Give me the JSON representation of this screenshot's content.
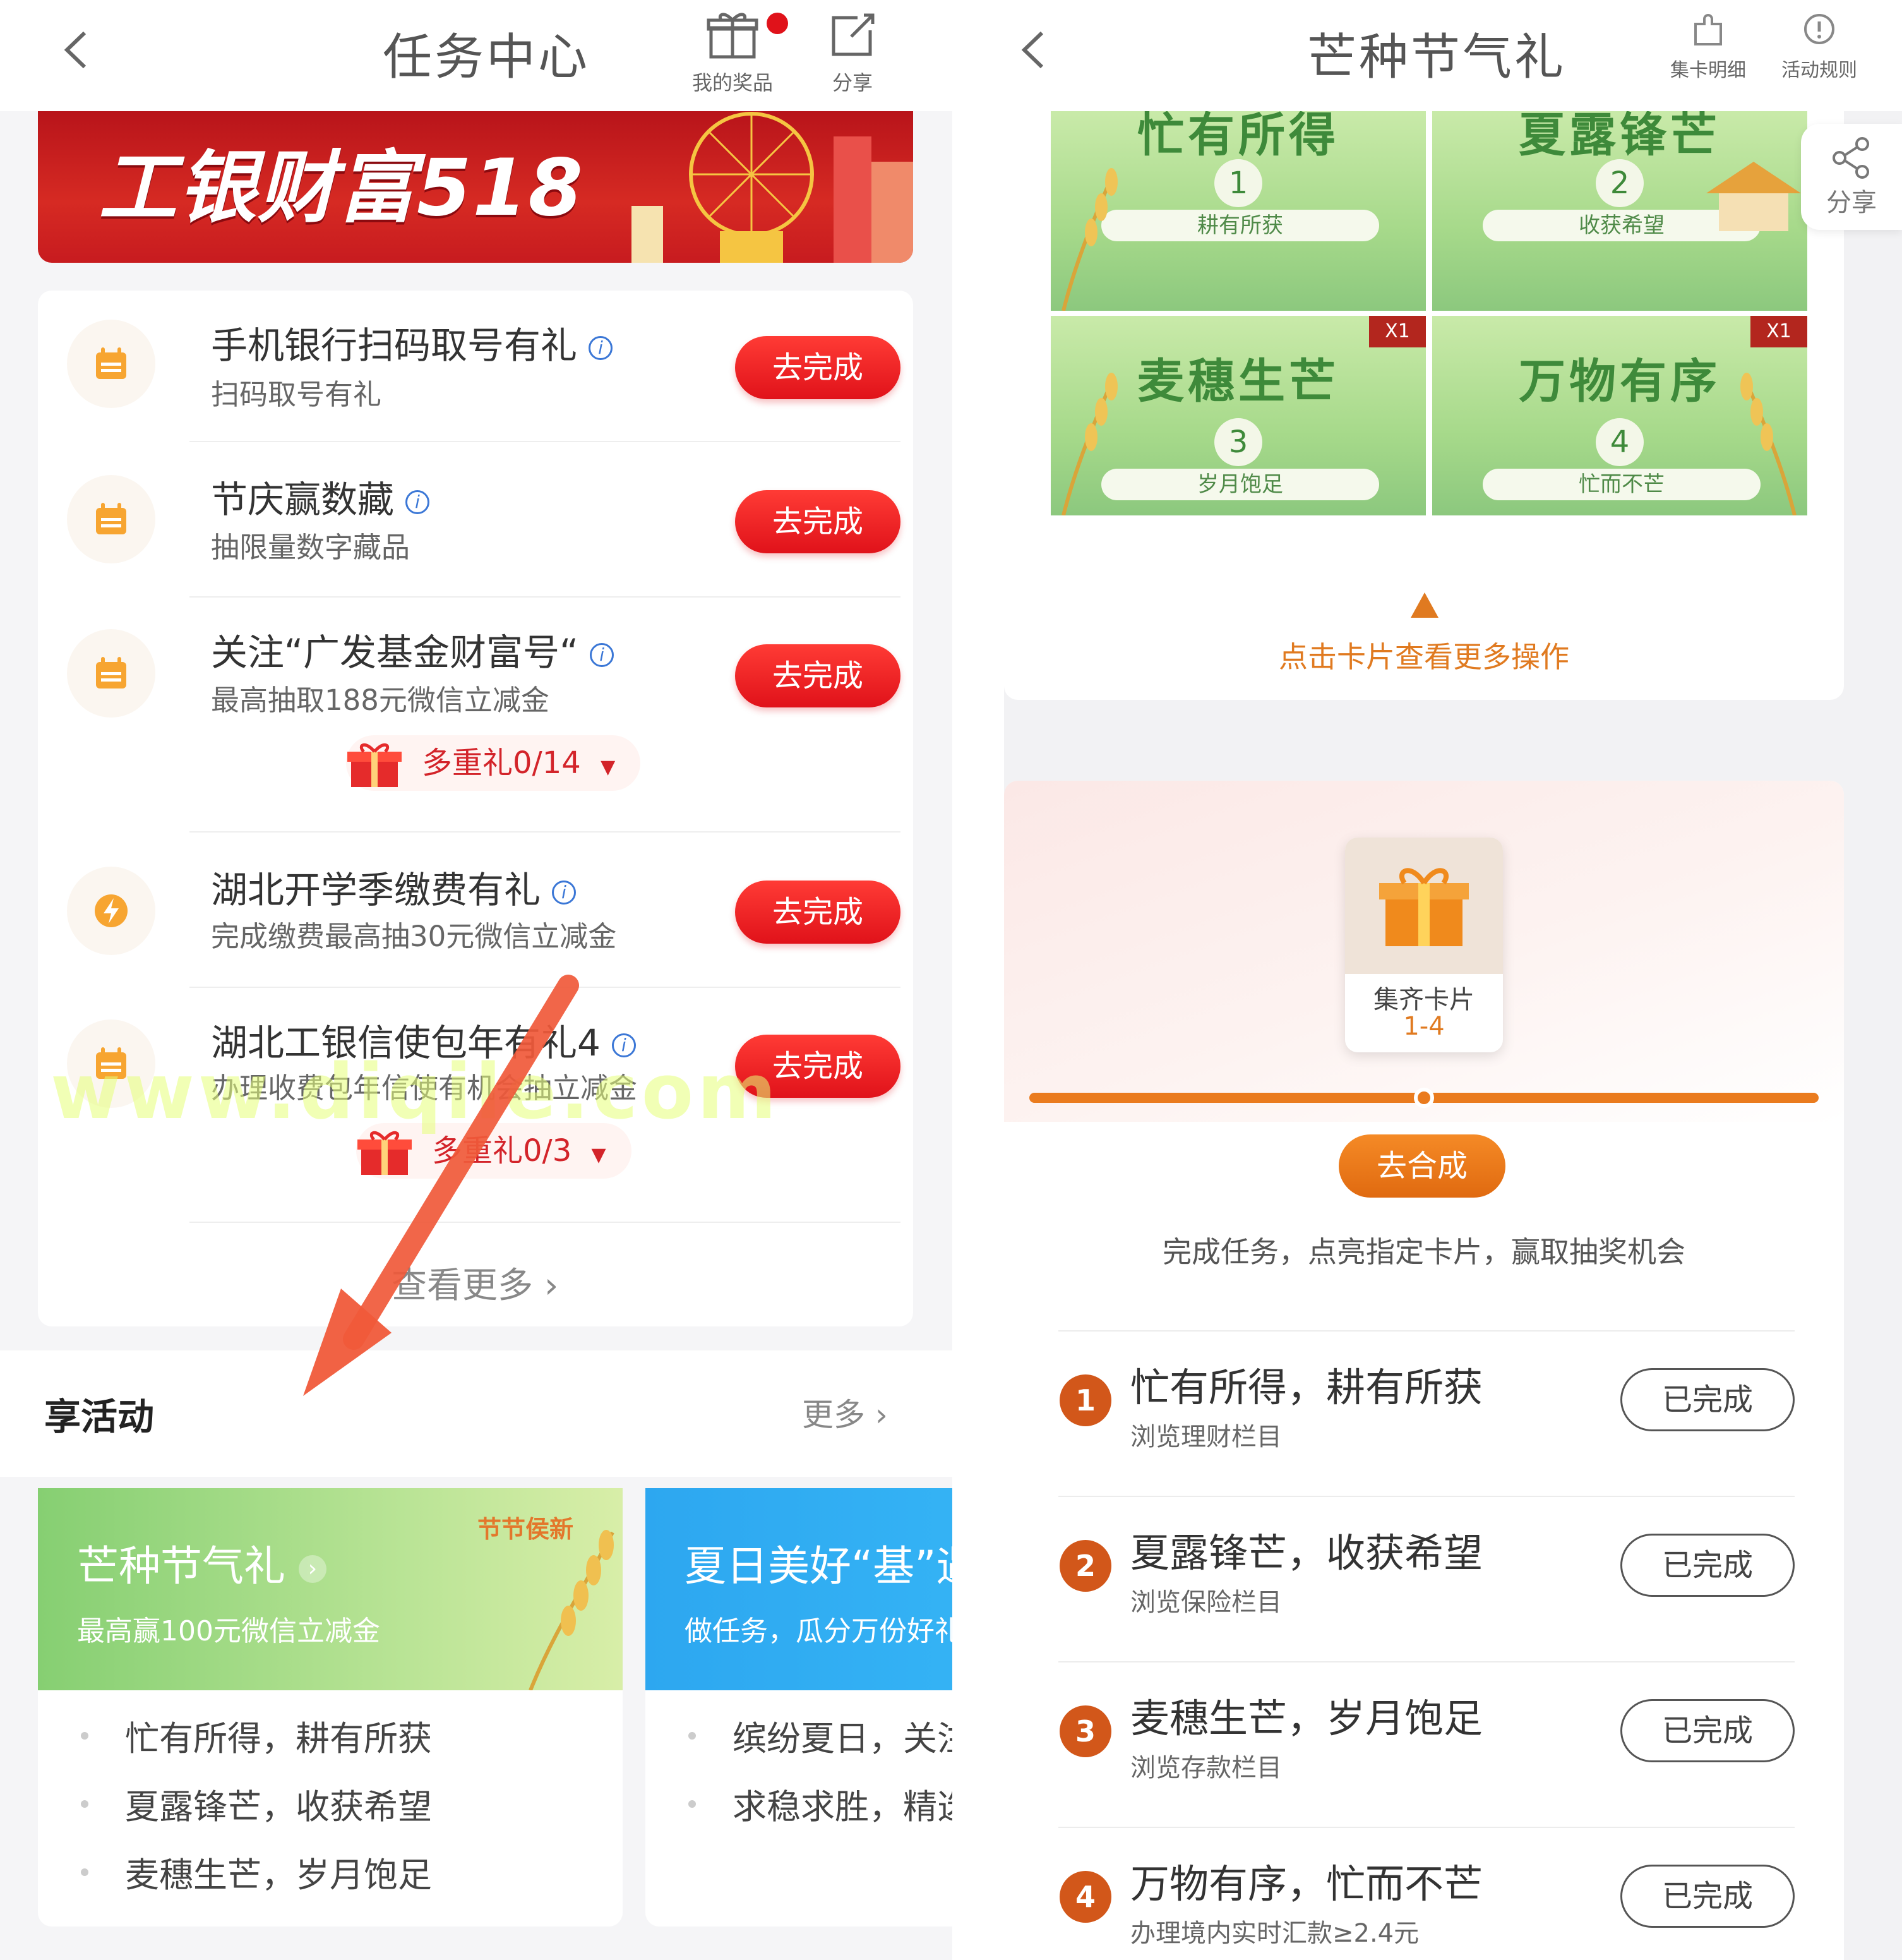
{
  "left": {
    "header": {
      "title": "任务中心",
      "prize_label": "我的奖品",
      "share_label": "分享"
    },
    "banner": {
      "text": "工银财富518"
    },
    "tasks": [
      {
        "name": "手机银行扫码取号有礼",
        "desc": "扫码取号有礼",
        "button": "去完成",
        "icon": "calendar-icon"
      },
      {
        "name": "节庆赢数藏",
        "desc": "抽限量数字藏品",
        "button": "去完成",
        "icon": "calendar-icon"
      },
      {
        "name": "关注“广发基金财富号“",
        "desc": "最高抽取188元微信立减金",
        "button": "去完成",
        "icon": "calendar-icon",
        "gift": "多重礼0/14"
      },
      {
        "name": "湖北开学季缴费有礼",
        "desc": "完成缴费最高抽30元微信立减金",
        "button": "去完成",
        "icon": "lightning-icon"
      },
      {
        "name": "湖北工银信使包年有礼4",
        "desc": "办理收费包年信使有机会抽立减金",
        "button": "去完成",
        "icon": "calendar-icon",
        "gift": "多重礼0/3"
      }
    ],
    "view_more": "查看更多",
    "section": {
      "title": "享活动",
      "more": "更多"
    },
    "activities": [
      {
        "title": "芒种节气礼",
        "subtitle": "最高赢100元微信立减金",
        "tag": "节节侯新",
        "items": [
          "忙有所得，耕有所获",
          "夏露锋芒，收获希望",
          "麦穗生芒，岁月饱足"
        ]
      },
      {
        "title": "夏日美好“基”遇",
        "subtitle": "做任务，瓜分万份好礼",
        "items": [
          "缤纷夏日，关注",
          "求稳求胜，精选"
        ]
      }
    ],
    "watermark": "www.diqile.com"
  },
  "right": {
    "header": {
      "title": "芒种节气礼",
      "detail_label": "集卡明细",
      "rules_label": "活动规则"
    },
    "float_share": "分享",
    "cards": [
      {
        "title": "忙有所得",
        "num": "1",
        "label": "耕有所获",
        "badge": ""
      },
      {
        "title": "夏露锋芒",
        "num": "2",
        "label": "收获希望",
        "badge": ""
      },
      {
        "title": "麦穗生芒",
        "num": "3",
        "label": "岁月饱足",
        "badge": "X1"
      },
      {
        "title": "万物有序",
        "num": "4",
        "label": "忙而不芒",
        "badge": "X1"
      }
    ],
    "tap_hint": "点击卡片查看更多操作",
    "collect": {
      "label": "集齐卡片",
      "range": "1-4"
    },
    "progress": 0.5,
    "synth_button": "去合成",
    "desc": "完成任务，点亮指定卡片，赢取抽奖机会",
    "tasks": [
      {
        "num": "1",
        "title": "忙有所得，耕有所获",
        "sub": "浏览理财栏目",
        "status": "已完成"
      },
      {
        "num": "2",
        "title": "夏露锋芒，收获希望",
        "sub": "浏览保险栏目",
        "status": "已完成"
      },
      {
        "num": "3",
        "title": "麦穗生芒，岁月饱足",
        "sub": "浏览存款栏目",
        "status": "已完成"
      },
      {
        "num": "4",
        "title": "万物有序，忙而不芒",
        "sub": "办理境内实时汇款≥2.4元",
        "status": "已完成"
      }
    ]
  },
  "colors": {
    "primary_red": "#e0121a",
    "accent_orange": "#ea7b1e",
    "info_blue": "#3b77d6"
  }
}
